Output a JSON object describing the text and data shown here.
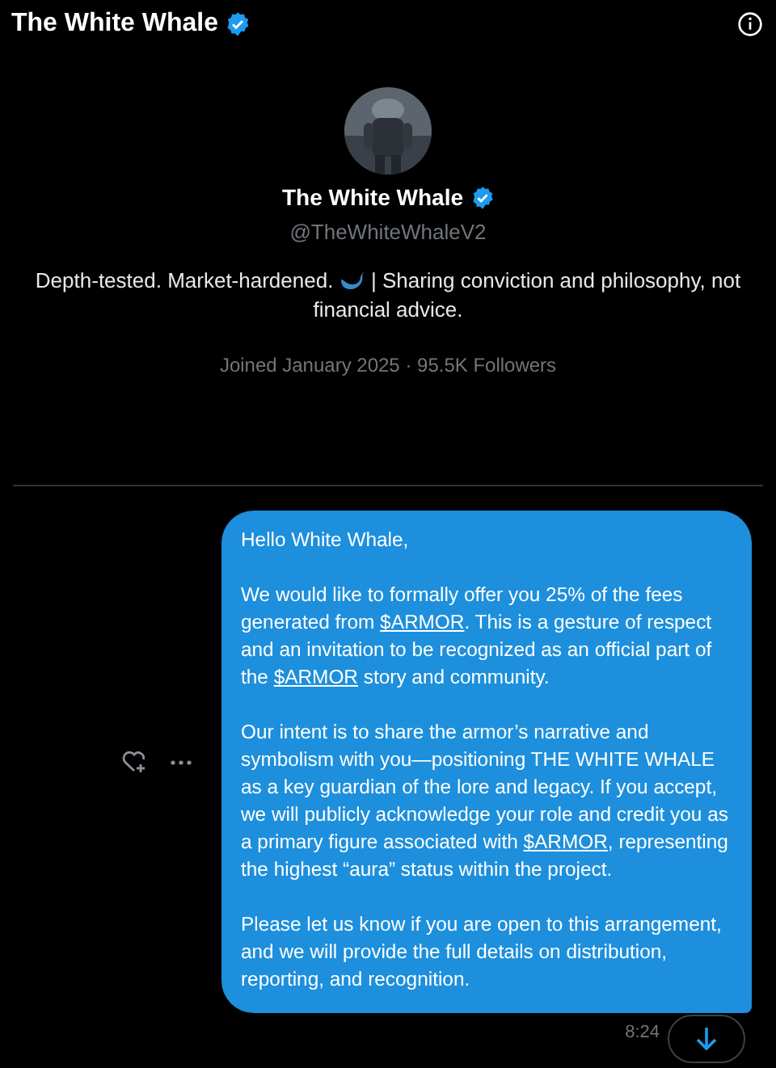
{
  "header": {
    "title": "The White Whale",
    "verified": true
  },
  "profile": {
    "name": "The White Whale",
    "verified": true,
    "handle": "@TheWhiteWhaleV2",
    "bio_before": "Depth-tested. Market-hardened.",
    "bio_after": "| Sharing conviction and philosophy, not financial advice.",
    "meta": "Joined January 2025 · 95.5K Followers"
  },
  "message": {
    "paragraphs": [
      [
        {
          "text": "Hello White Whale,"
        }
      ],
      [
        {
          "text": "We would like to formally offer you 25% of the fees generated from "
        },
        {
          "text": "$ARMOR",
          "kind": "link"
        },
        {
          "text": ". This is a gesture of respect and an invitation to be recognized as an official part of the "
        },
        {
          "text": "$ARMOR",
          "kind": "link"
        },
        {
          "text": " story and community."
        }
      ],
      [
        {
          "text": "Our intent is to share the armor’s narrative and symbolism with you—positioning THE WHITE WHALE as a key guardian of the lore and legacy. If you accept, we will publicly acknowledge your role and credit you as a primary figure associated with "
        },
        {
          "text": "$ARMOR",
          "kind": "link"
        },
        {
          "text": ", representing the highest “aura” status within the project."
        }
      ],
      [
        {
          "text": "Please let us know if you are open to this arrangement, and we will provide the full details on distribution, reporting, and recognition."
        }
      ]
    ],
    "time": "8:24"
  }
}
